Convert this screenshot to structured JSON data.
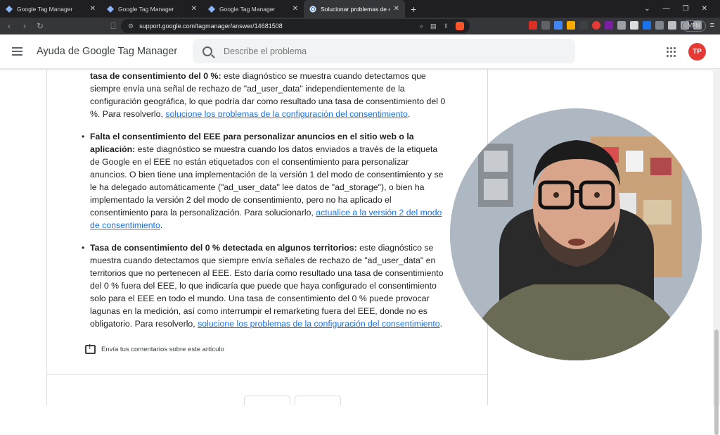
{
  "browser": {
    "tabs": [
      {
        "title": "Google Tag Manager"
      },
      {
        "title": "Google Tag Manager"
      },
      {
        "title": "Google Tag Manager"
      },
      {
        "title": "Solucionar problemas de etiqu"
      }
    ],
    "url": "support.google.com/tagmanager/answer/14681508",
    "vpn_label": "VPN"
  },
  "header": {
    "title": "Ayuda de Google Tag Manager",
    "search_placeholder": "Describe el problema",
    "avatar_initials": "TP"
  },
  "article": {
    "item0": {
      "bold": "tasa de consentimiento del 0 %:",
      "text": " este diagnóstico se muestra cuando detectamos que siempre envía una señal de rechazo de \"ad_user_data\" independientemente de la configuración geográfica, lo que podría dar como resultado una tasa de consentimiento del 0 %. Para resolverlo, ",
      "link": "solucione los problemas de la configuración del consentimiento",
      "end": "."
    },
    "item1": {
      "bold": "Falta el consentimiento del EEE para personalizar anuncios en el sitio web o la aplicación:",
      "text": " este diagnóstico se muestra cuando los datos enviados a través de la etiqueta de Google en el EEE no están etiquetados con el consentimiento para personalizar anuncios. O bien tiene una implementación de la versión 1 del modo de consentimiento y se le ha delegado automáticamente (\"ad_user_data\" lee datos de \"ad_storage\"), o bien ha implementado la versión 2 del modo de consentimiento, pero no ha aplicado el consentimiento para la personalización. Para solucionarlo, ",
      "link": "actualice a la versión 2 del modo de consentimiento",
      "end": "."
    },
    "item2": {
      "bold": "Tasa de consentimiento del 0 % detectada en algunos territorios:",
      "text": " este diagnóstico se muestra cuando detectamos que siempre envía señales de rechazo de \"ad_user_data\" en territorios que no pertenecen al EEE. Esto daría como resultado una tasa de consentimiento del 0 % fuera del EEE, lo que indicaría que puede que haya configurado el consentimiento solo para el EEE en todo el mundo. Una tasa de consentimiento del 0 % puede provocar lagunas en la medición, así como interrumpir el remarketing fuera del EEE, donde no es obligatorio. Para resolverlo, ",
      "link": "solucione los problemas de la configuración del consentimiento",
      "end": "."
    },
    "feedback": "Envía tus comentarios sobre este artículo"
  },
  "icons": {
    "hamburger": "menu-icon",
    "search": "search-icon",
    "apps": "apps-grid-icon",
    "feedback": "feedback-icon"
  },
  "colors": {
    "link": "#1a73e8",
    "avatar": "#e53935"
  }
}
